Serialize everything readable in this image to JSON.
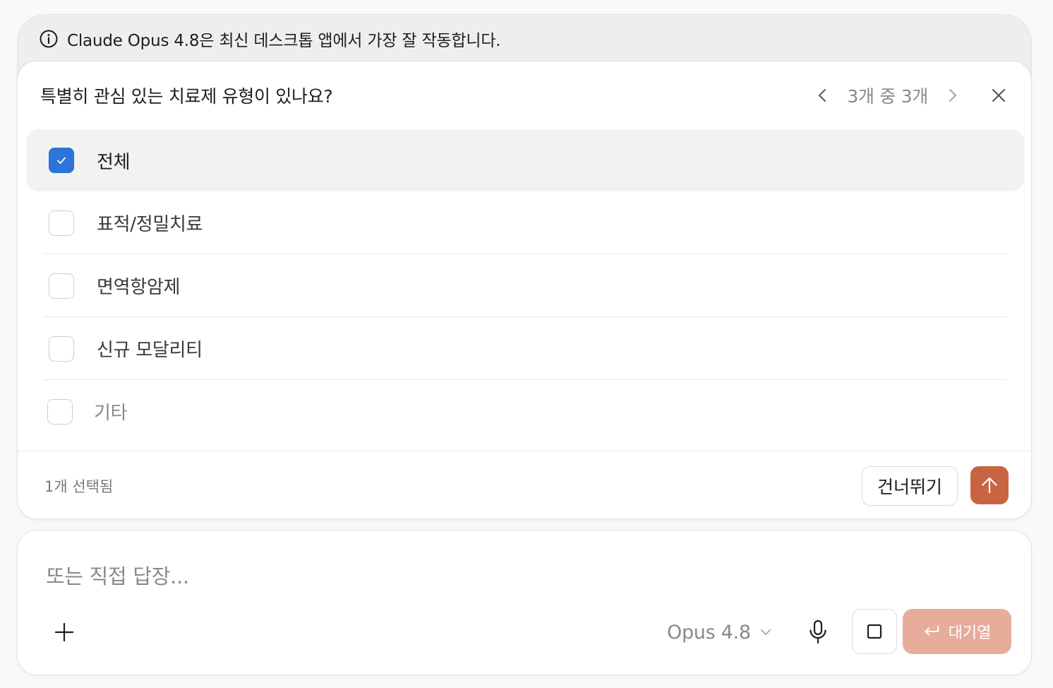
{
  "banner": {
    "text": "Claude Opus 4.8은 최신 데스크톱 앱에서 가장 잘 작동합니다.",
    "icon": "info-icon"
  },
  "question": {
    "title": "특별히 관심 있는 치료제 유형이 있나요?",
    "pager": "3개 중 3개",
    "options": [
      {
        "label": "전체",
        "checked": true
      },
      {
        "label": "표적/정밀치료",
        "checked": false
      },
      {
        "label": "면역항암제",
        "checked": false
      },
      {
        "label": "신규 모달리티",
        "checked": false
      },
      {
        "label": "기타",
        "checked": false
      }
    ],
    "selected_count": "1개 선택됨",
    "skip_label": "건너뛰기"
  },
  "composer": {
    "placeholder": "또는 직접 답장...",
    "model": "Opus 4.8",
    "queue_label": "대기열"
  },
  "colors": {
    "accent": "#c96442",
    "checkbox_checked": "#2c74d9",
    "queue_button": "#e6ad9b"
  }
}
